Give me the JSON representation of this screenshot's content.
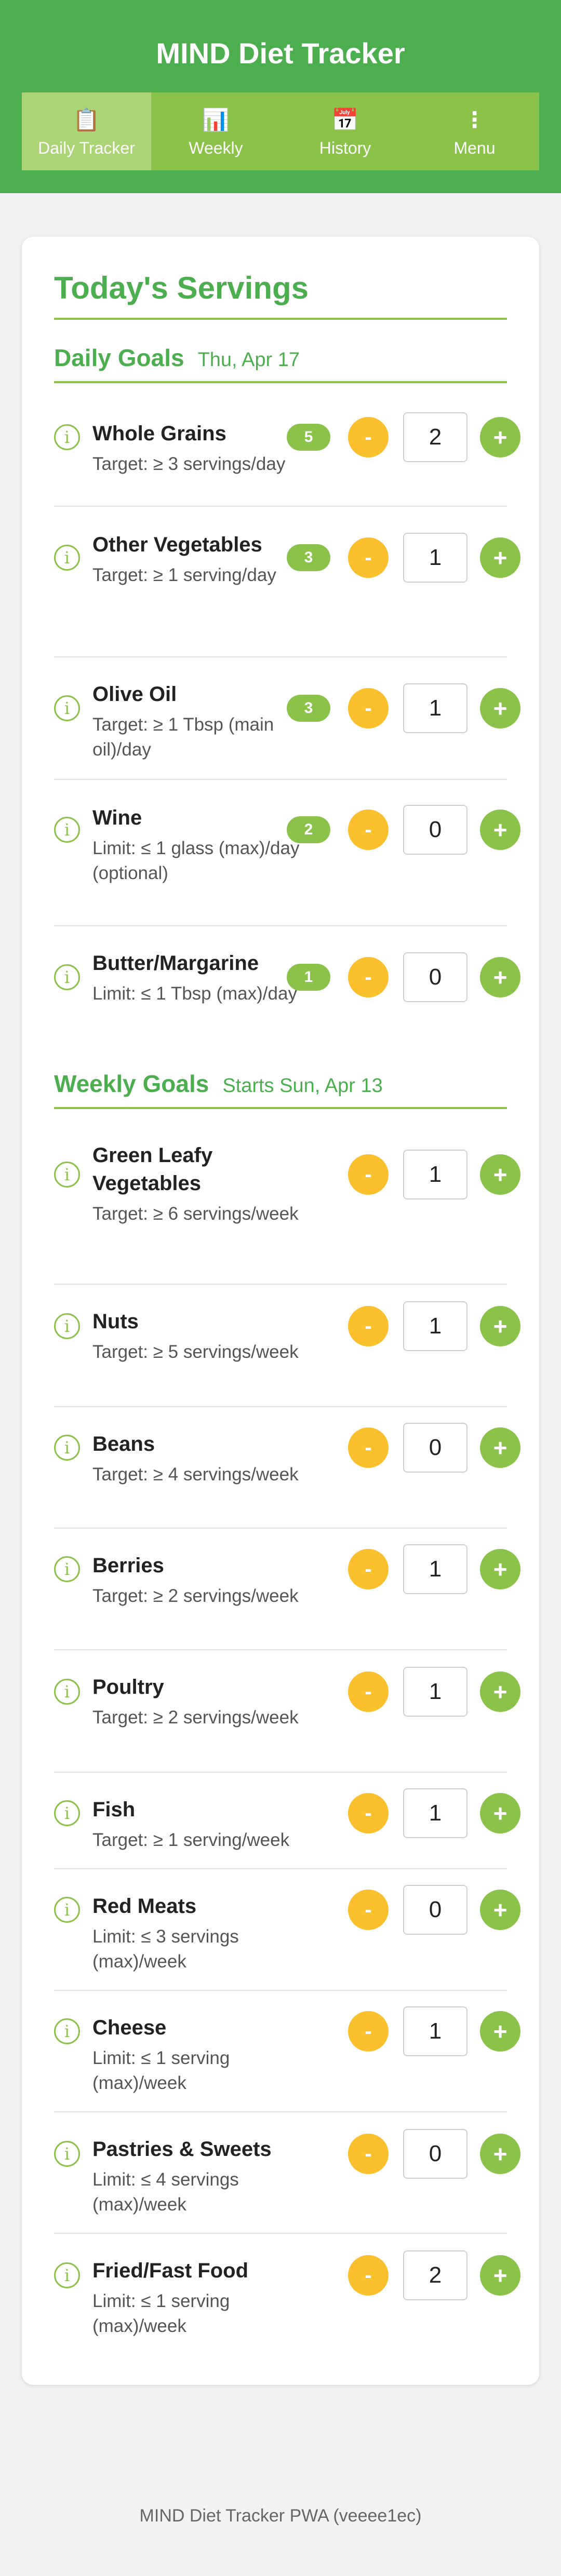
{
  "header": {
    "title": "MIND Diet Tracker"
  },
  "tabs": [
    {
      "label": "Daily Tracker",
      "icon": "clipboard-icon"
    },
    {
      "label": "Weekly",
      "icon": "bar-chart-icon"
    },
    {
      "label": "History",
      "icon": "calendar-icon"
    },
    {
      "label": "Menu",
      "icon": "more-vertical-icon"
    }
  ],
  "main": {
    "title": "Today's Servings",
    "daily": {
      "title": "Daily Goals",
      "date": "Thu, Apr 17",
      "items": [
        {
          "name": "Whole Grains",
          "target": "Target: ≥ 3 servings/day",
          "badge": "5",
          "count": "2"
        },
        {
          "name": "Other Vegetables",
          "target": "Target: ≥ 1 serving/day",
          "badge": "3",
          "count": "1"
        },
        {
          "name": "Olive Oil",
          "target": "Target: ≥ 1 Tbsp (main oil)/day",
          "badge": "3",
          "count": "1"
        },
        {
          "name": "Wine",
          "target": "Limit: ≤ 1 glass (max)/day (optional)",
          "badge": "2",
          "count": "0"
        },
        {
          "name": "Butter/Margarine",
          "target": "Limit: ≤ 1 Tbsp (max)/day",
          "badge": "1",
          "count": "0"
        }
      ]
    },
    "weekly": {
      "title": "Weekly Goals",
      "date": "Starts Sun, Apr 13",
      "items": [
        {
          "name": "Green Leafy Vegetables",
          "target": "Target: ≥ 6 servings/week",
          "count": "1"
        },
        {
          "name": "Nuts",
          "target": "Target: ≥ 5 servings/week",
          "count": "1"
        },
        {
          "name": "Beans",
          "target": "Target: ≥ 4 servings/week",
          "count": "0"
        },
        {
          "name": "Berries",
          "target": "Target: ≥ 2 servings/week",
          "count": "1"
        },
        {
          "name": "Poultry",
          "target": "Target: ≥ 2 servings/week",
          "count": "1"
        },
        {
          "name": "Fish",
          "target": "Target: ≥ 1 serving/week",
          "count": "1"
        },
        {
          "name": "Red Meats",
          "target": "Limit: ≤ 3 servings (max)/week",
          "count": "0"
        },
        {
          "name": "Cheese",
          "target": "Limit: ≤ 1 serving (max)/week",
          "count": "1"
        },
        {
          "name": "Pastries & Sweets",
          "target": "Limit: ≤ 4 servings (max)/week",
          "count": "0"
        },
        {
          "name": "Fried/Fast Food",
          "target": "Limit: ≤ 1 serving (max)/week",
          "count": "2"
        }
      ]
    }
  },
  "controls": {
    "minus": "-",
    "plus": "+",
    "info": "i"
  },
  "footer": {
    "text": "MIND Diet Tracker PWA (veeee1ec)"
  },
  "colors": {
    "primary": "#4cae4f",
    "accent": "#8bc34a",
    "minus": "#fbc02d",
    "background": "#f2f2f2"
  }
}
